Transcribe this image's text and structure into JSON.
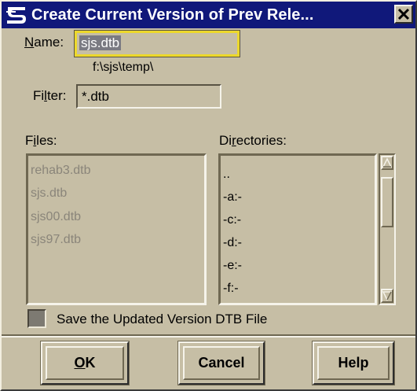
{
  "window": {
    "title": "Create Current Version of Prev Rele..."
  },
  "name_field": {
    "label_underline": "N",
    "label_rest": "ame:",
    "value": "sjs.dtb"
  },
  "path_text": "f:\\sjs\\temp\\",
  "filter_field": {
    "label_pre": "Fi",
    "label_underline": "l",
    "label_post": "ter:",
    "value": "*.dtb"
  },
  "files": {
    "label_pre": "F",
    "label_underline": "i",
    "label_post": "les:",
    "items": [
      "rehab3.dtb",
      "sjs.dtb",
      "sjs00.dtb",
      "sjs97.dtb"
    ]
  },
  "directories": {
    "label_pre": "Di",
    "label_underline": "r",
    "label_post": "ectories:",
    "items": [
      "..",
      "-a:-",
      "-c:-",
      "-d:-",
      "-e:-",
      "-f:-"
    ]
  },
  "save_option": {
    "label": "Save the Updated Version DTB File",
    "checked": false
  },
  "buttons": {
    "ok_underline": "O",
    "ok_rest": "K",
    "cancel": "Cancel",
    "help": "Help"
  },
  "icons": {
    "title_logo": "bentley-b-logo-icon",
    "close": "close-icon",
    "scroll_up": "arrow-up-icon",
    "scroll_down": "arrow-down-icon"
  },
  "colors": {
    "titlebar": "#10187a",
    "dialog_bg": "#c6bea5",
    "name_focus_border": "#ecd82b",
    "disabled_text": "#8a857a"
  }
}
